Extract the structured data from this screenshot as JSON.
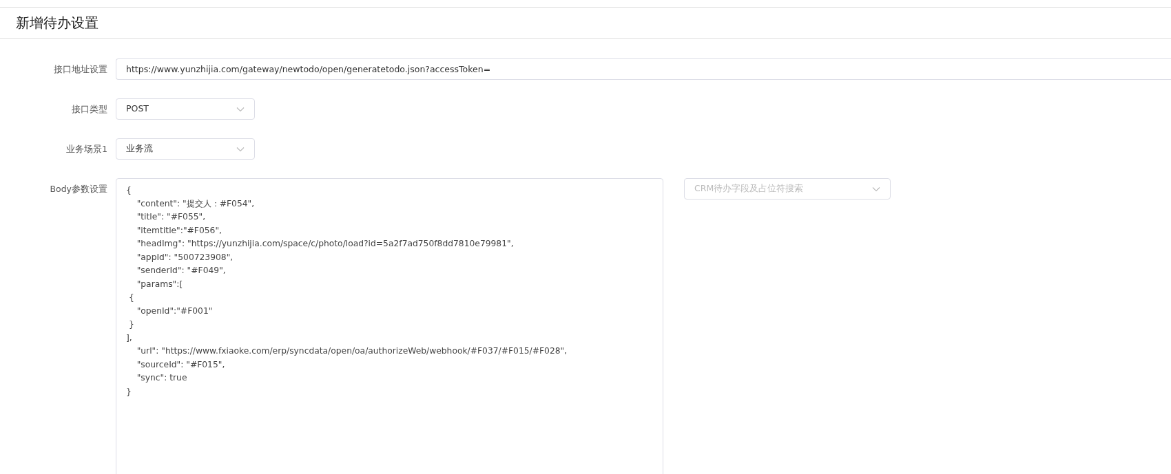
{
  "page_title": "新增待办设置",
  "fields": [
    {
      "kind": "text",
      "label": "接口地址设置",
      "value": "https://www.yunzhijia.com/gateway/newtodo/open/generatetodo.json?accessToken="
    },
    {
      "kind": "select",
      "label": "接口类型",
      "value": "POST"
    },
    {
      "kind": "select",
      "label": "业务场景1",
      "value": "业务流"
    },
    {
      "kind": "body",
      "label": "Body参数设置",
      "value": "{\n    \"content\": \"提交人：#F054\",\n    \"title\": \"#F055\",\n    \"itemtitle\":\"#F056\",\n    \"headImg\": \"https://yunzhijia.com/space/c/photo/load?id=5a2f7ad750f8dd7810e79981\",\n    \"appId\": \"500723908\",\n    \"senderId\": \"#F049\",\n    \"params\":[\n {\n    \"openId\":\"#F001\"\n }\n],\n    \"url\": \"https://www.fxiaoke.com/erp/syncdata/open/oa/authorizeWeb/webhook/#F037/#F015/#F028\",\n    \"sourceId\": \"#F015\",\n    \"sync\": true\n}",
      "search_placeholder": "CRM待办字段及占位符搜索"
    }
  ]
}
